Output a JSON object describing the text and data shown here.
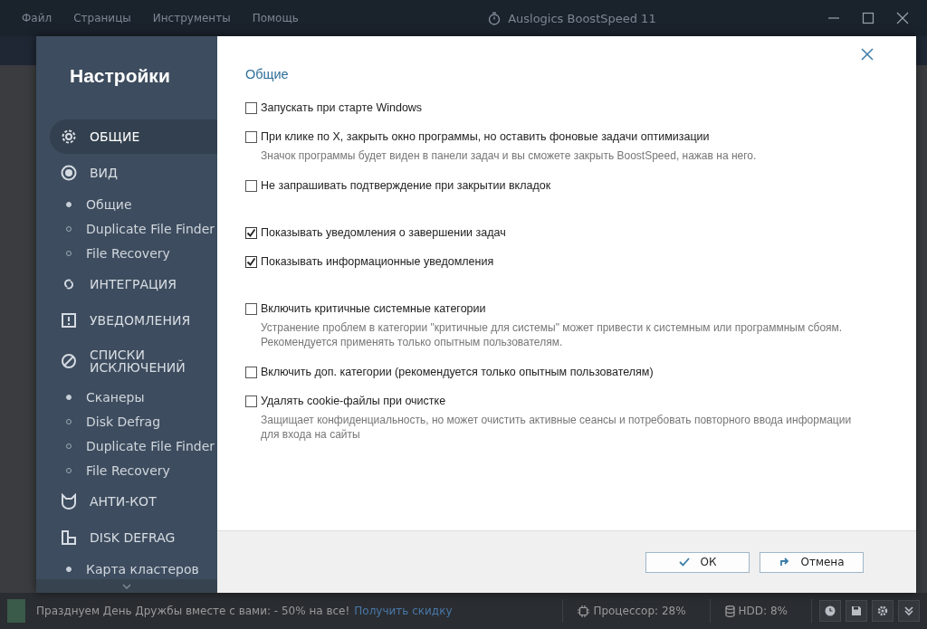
{
  "window": {
    "menu": [
      "Файл",
      "Страницы",
      "Инструменты",
      "Помощь"
    ],
    "title": "Auslogics BoostSpeed 11"
  },
  "dialog": {
    "sidebar": {
      "title": "Настройки",
      "sections": [
        {
          "label": "ОБЩИЕ",
          "selected": true
        },
        {
          "label": "ВИД",
          "selected": false,
          "children": [
            {
              "label": "Общие",
              "selected": true
            },
            {
              "label": "Duplicate File Finder",
              "selected": false
            },
            {
              "label": "File Recovery",
              "selected": false
            }
          ]
        },
        {
          "label": "ИНТЕГРАЦИЯ",
          "selected": false
        },
        {
          "label": "УВЕДОМЛЕНИЯ",
          "selected": false
        },
        {
          "label": "СПИСКИ ИСКЛЮЧЕНИЙ",
          "selected": false,
          "children": [
            {
              "label": "Сканеры",
              "selected": true
            },
            {
              "label": "Disk Defrag",
              "selected": false
            },
            {
              "label": "Duplicate File Finder",
              "selected": false
            },
            {
              "label": "File Recovery",
              "selected": false
            }
          ]
        },
        {
          "label": "АНТИ-КОТ",
          "selected": false
        },
        {
          "label": "DISK DEFRAG",
          "selected": false,
          "children": [
            {
              "label": "Карта кластеров",
              "selected": true
            }
          ]
        }
      ]
    },
    "heading": "Общие",
    "option_groups": [
      [
        {
          "label": "Запускать при старте Windows",
          "checked": false
        },
        {
          "label": "При клике по X, закрыть окно программы, но оставить фоновые задачи оптимизации",
          "checked": false,
          "hint": "Значок программы будет виден в панели задач и вы сможете закрыть BoostSpeed, нажав на него."
        },
        {
          "label": "Не запрашивать подтверждение при закрытии вкладок",
          "checked": false
        }
      ],
      [
        {
          "label": "Показывать уведомления о завершении задач",
          "checked": true
        },
        {
          "label": "Показывать информационные уведомления",
          "checked": true
        }
      ],
      [
        {
          "label": "Включить критичные системные категории",
          "checked": false,
          "hint": "Устранение проблем в категории \"критичные для системы\" может привести к системным или программным сбоям.\nРекомендуется применять только опытным пользователям."
        },
        {
          "label": "Включить доп. категории (рекомендуется только опытным пользователям)",
          "checked": false
        },
        {
          "label": "Удалять cookie-файлы при очистке",
          "checked": false,
          "hint": "Защищает конфиденциальность, но может очистить активные сеансы и потребовать повторного ввода информации\nдля входа на сайты"
        }
      ]
    ],
    "buttons": {
      "ok": "ОК",
      "cancel": "Отмена"
    }
  },
  "status_bar": {
    "promo": "Празднуем День Дружбы вместе с вами: - 50% на все!",
    "promo_link": "Получить скидку",
    "cpu": "Процессор: 28%",
    "hdd": "HDD: 8%"
  }
}
